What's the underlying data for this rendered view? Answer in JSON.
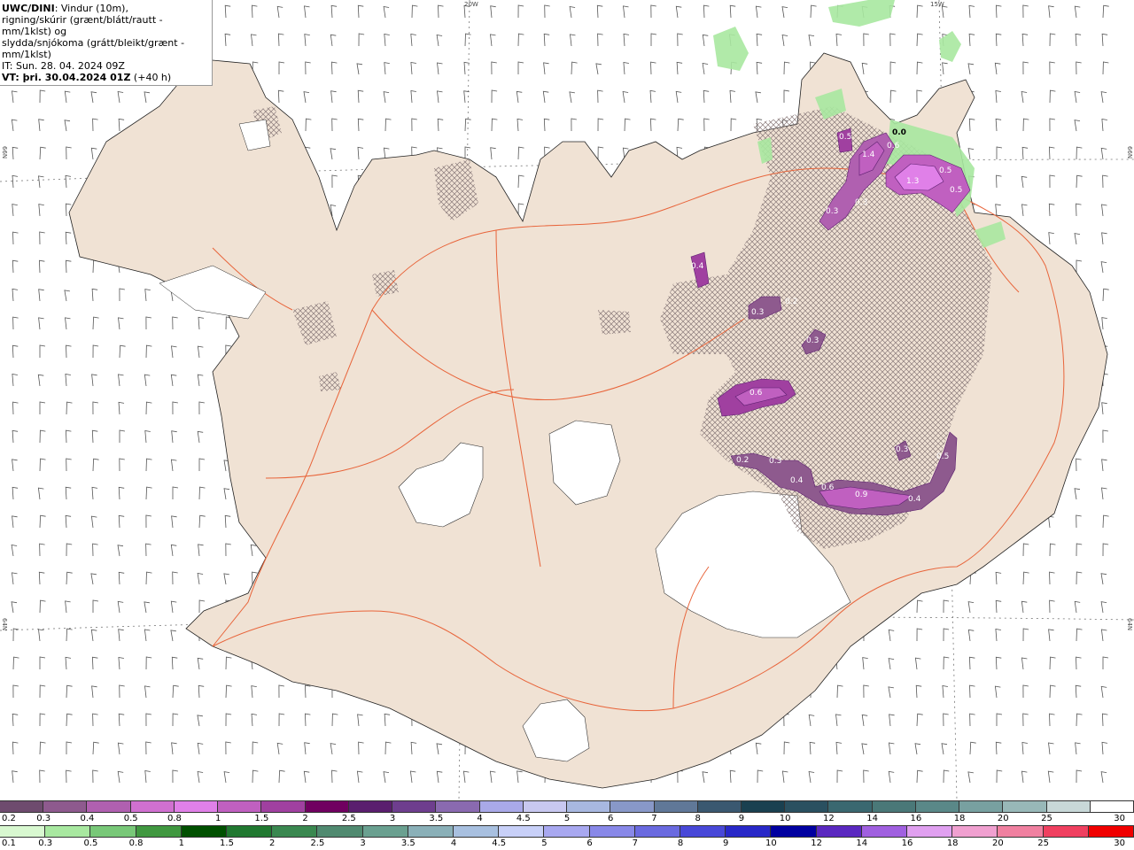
{
  "header": {
    "title_bold": "UWC/DINI",
    "title_rest": ": Vindur (10m),",
    "line2": "rigning/skúrir (grænt/blátt/rautt - mm/1klst) og",
    "line3": "slydda/snjókoma (grátt/bleikt/grænt - mm/1klst)",
    "it_line": "IT: Sun. 28. 04. 2024 09Z",
    "vt_bold": "VT: þri. 30.04.2024 01Z",
    "vt_rest": " (+40 h)"
  },
  "graticule": {
    "top_left": "20W",
    "top_right": "15W",
    "left_upper": "66N",
    "left_lower": "64N",
    "right_upper": "66N",
    "right_lower": "64N"
  },
  "precip_labels": [
    {
      "text": "0.5"
    },
    {
      "text": "0.6"
    },
    {
      "text": "0.0"
    },
    {
      "text": "1.4"
    },
    {
      "text": "1.3"
    },
    {
      "text": "0.5"
    },
    {
      "text": "0.5"
    },
    {
      "text": "0.3"
    },
    {
      "text": "0.3"
    },
    {
      "text": "0.4"
    },
    {
      "text": "0.3"
    },
    {
      "text": "0.2"
    },
    {
      "text": "0.3"
    },
    {
      "text": "0.6"
    },
    {
      "text": "0.2"
    },
    {
      "text": "0.3"
    },
    {
      "text": "0.4"
    },
    {
      "text": "0.6"
    },
    {
      "text": "0.9"
    },
    {
      "text": "0.4"
    },
    {
      "text": "0.5"
    },
    {
      "text": "0.3"
    }
  ],
  "scale_snow": {
    "labels": [
      "0.2",
      "0.3",
      "0.4",
      "0.5",
      "0.8",
      "1",
      "1.5",
      "2",
      "2.5",
      "3",
      "3.5",
      "4",
      "4.5",
      "5",
      "6",
      "7",
      "8",
      "9",
      "10",
      "12",
      "14",
      "16",
      "18",
      "20",
      "25",
      "30"
    ],
    "colors": [
      "#6e4b6e",
      "#8e5a8e",
      "#b060b0",
      "#d070d0",
      "#e080e8",
      "#c060c0",
      "#a040a0",
      "#700060",
      "#5a1e6e",
      "#6e3e8e",
      "#8a6ab0",
      "#a9a9e8",
      "#c8c8f0",
      "#a8b8e0",
      "#8898c8",
      "#607898",
      "#3a5870",
      "#1a4050",
      "#2a5060",
      "#3a6870",
      "#4a7878",
      "#5a8888",
      "#78a0a0",
      "#98b8b8",
      "#c8d8d8",
      "#ffffff"
    ]
  },
  "scale_rain": {
    "labels": [
      "0.1",
      "0.3",
      "0.5",
      "0.8",
      "1",
      "1.5",
      "2",
      "2.5",
      "3",
      "3.5",
      "4",
      "4.5",
      "5",
      "6",
      "7",
      "8",
      "9",
      "10",
      "12",
      "14",
      "16",
      "18",
      "20",
      "25",
      "30"
    ],
    "colors": [
      "#d8f8d0",
      "#a8e8a0",
      "#78c878",
      "#409840",
      "#005000",
      "#207830",
      "#3a8850",
      "#508a70",
      "#6aa090",
      "#8ab0b8",
      "#a8c0e0",
      "#c8d0f8",
      "#a8a8f0",
      "#8888e8",
      "#6a6ae0",
      "#4848d8",
      "#2828c8",
      "#0000a0",
      "#5a28c0",
      "#a060e0",
      "#e0a0f0",
      "#f0a0d0",
      "#f080a0",
      "#f04060",
      "#f00000"
    ]
  }
}
